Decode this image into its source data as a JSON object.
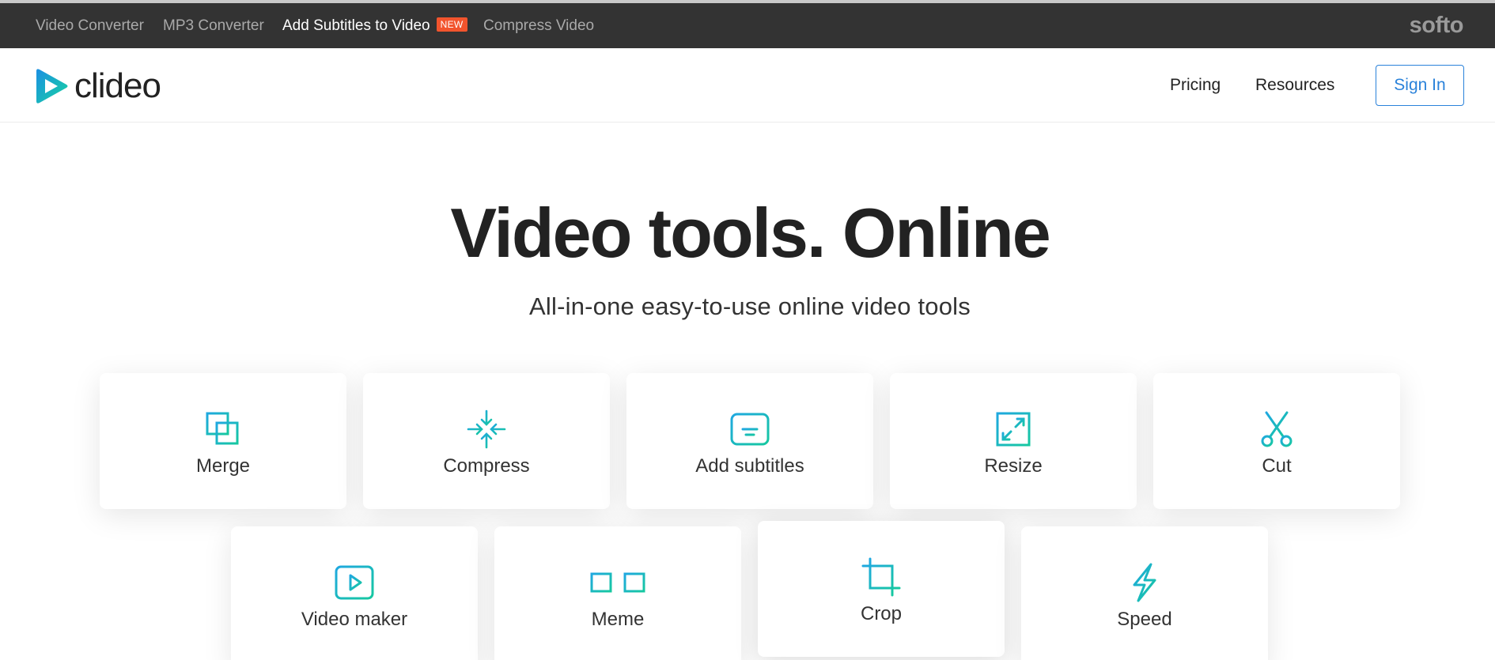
{
  "topbar": {
    "links": [
      {
        "label": "Video Converter"
      },
      {
        "label": "MP3 Converter"
      },
      {
        "label": "Add Subtitles to Video",
        "badge": "NEW"
      },
      {
        "label": "Compress Video"
      }
    ],
    "brand": "softo"
  },
  "header": {
    "logo_text": "clideo",
    "nav": {
      "pricing": "Pricing",
      "resources": "Resources"
    },
    "sign_in": "Sign In"
  },
  "hero": {
    "title": "Video tools. Online",
    "subtitle": "All-in-one easy-to-use online video tools"
  },
  "tools": [
    {
      "label": "Merge",
      "icon": "merge-icon"
    },
    {
      "label": "Compress",
      "icon": "compress-icon"
    },
    {
      "label": "Add subtitles",
      "icon": "subtitles-icon"
    },
    {
      "label": "Resize",
      "icon": "resize-icon"
    },
    {
      "label": "Cut",
      "icon": "scissors-icon"
    },
    {
      "label": "Video maker",
      "icon": "video-play-icon"
    },
    {
      "label": "Meme",
      "icon": "glasses-icon"
    },
    {
      "label": "Crop",
      "icon": "crop-icon"
    },
    {
      "label": "Speed",
      "icon": "lightning-icon"
    }
  ],
  "colors": {
    "topbar_bg": "#333333",
    "accent_blue": "#2a82da",
    "badge": "#f2542d",
    "icon_gradient": [
      "#1fa8e0",
      "#16c8a0"
    ]
  }
}
